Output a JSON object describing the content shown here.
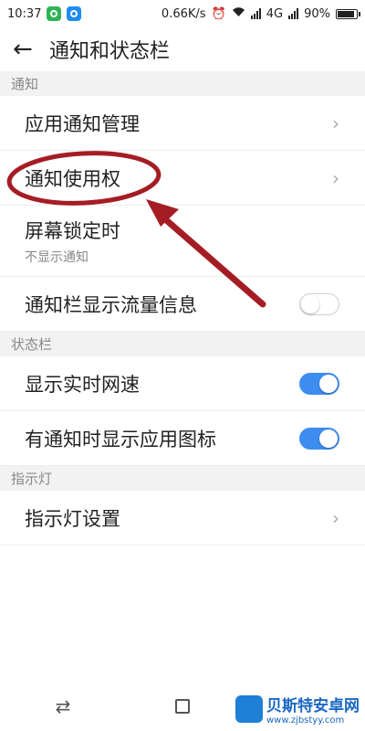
{
  "status_bar": {
    "time": "10:37",
    "speed": "0.66K/s",
    "network": "4G",
    "battery_text": "90%",
    "battery_level": 0.9
  },
  "header": {
    "title": "通知和状态栏"
  },
  "sections": {
    "notify": "通知",
    "statusbar": "状态栏",
    "indicator": "指示灯"
  },
  "rows": {
    "app_notify": "应用通知管理",
    "notify_access": "通知使用权",
    "lock_screen": "屏幕锁定时",
    "lock_screen_sub": "不显示通知",
    "traffic_info": "通知栏显示流量信息",
    "realtime_speed": "显示实时网速",
    "show_app_icon": "有通知时显示应用图标",
    "indicator_settings": "指示灯设置"
  },
  "toggles": {
    "traffic_info": false,
    "realtime_speed": true,
    "show_app_icon": true
  },
  "colors": {
    "toggle_on": "#3d8cf0",
    "annotation": "#a51d24",
    "section_bg": "#f2f2f2"
  },
  "watermark": {
    "name": "贝斯特安卓网",
    "url": "www.zjbstyy.com"
  }
}
